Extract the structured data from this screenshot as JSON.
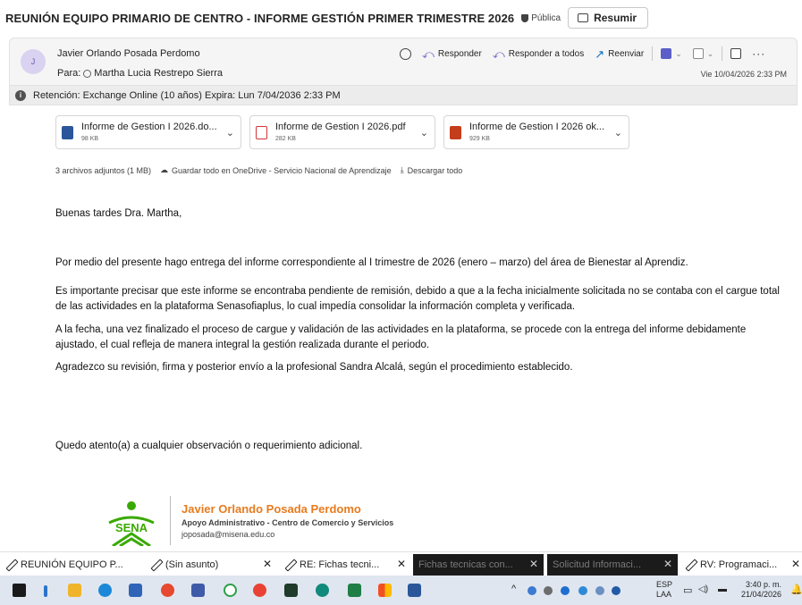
{
  "email": {
    "subject": "REUNIÓN EQUIPO PRIMARIO DE CENTRO - INFORME GESTIÓN PRIMER TRIMESTRE 2026",
    "visibility": "Pública",
    "summarize_label": "Resumir",
    "avatar_initial": "J",
    "sender": "Javier Orlando Posada Perdomo",
    "to_prefix": "Para:",
    "recipient": "Martha Lucia Restrepo Sierra",
    "date": "Vie 10/04/2026 2:33 PM",
    "retention": "Retención: Exchange Online (10 años) Expira: Lun 7/04/2036 2:33 PM",
    "actions": {
      "reply": "Responder",
      "reply_all": "Responder a todos",
      "forward": "Reenviar"
    }
  },
  "attachments": [
    {
      "name": "Informe de Gestion I 2026.do...",
      "size": "98 KB",
      "icon": "word-icon",
      "color": "#2b579a"
    },
    {
      "name": "Informe de Gestion I 2026.pdf",
      "size": "282 KB",
      "icon": "pdf-icon",
      "color": "#d13438"
    },
    {
      "name": "Informe de Gestion I 2026 ok...",
      "size": "929 KB",
      "icon": "powerpoint-icon",
      "color": "#c43e1c"
    }
  ],
  "attachments_summary": {
    "count": "3 archivos adjuntos (1 MB)",
    "save_onedrive": "Guardar todo en OneDrive - Servicio Nacional de Aprendizaje",
    "download_all": "Descargar todo"
  },
  "body": {
    "greeting": "Buenas tardes Dra. Martha,",
    "p1": "Por medio del presente hago entrega del informe correspondiente al I trimestre de 2026 (enero – marzo) del área de Bienestar al Aprendiz.",
    "p2": "Es importante precisar que este informe se encontraba pendiente de remisión, debido a que a la fecha inicialmente solicitada no se contaba con el cargue total de las actividades en la plataforma Senasofiaplus, lo cual impedía consolidar la información completa y verificada.",
    "p3": "A la fecha, una vez finalizado el proceso de cargue y validación de las actividades en la plataforma, se procede con la entrega del informe debidamente ajustado, el cual refleja de manera integral la gestión realizada durante el periodo.",
    "p4": "Agradezco su revisión, firma y posterior envío a la profesional Sandra Alcalá, según el procedimiento establecido.",
    "closing": "Quedo atento(a) a cualquier observación o requerimiento adicional."
  },
  "signature": {
    "logo_text": "SENA",
    "name": "Javier Orlando Posada Perdomo",
    "role": "Apoyo Administrativo - Centro de Comercio y Servicios",
    "email": "joposada@misena.edu.co"
  },
  "draft_tabs": [
    {
      "label": "REUNIÓN EQUIPO P..."
    },
    {
      "label": "(Sin asunto)"
    },
    {
      "label": "RE: Fichas tecni..."
    },
    {
      "label": "Fichas tecnicas con..."
    },
    {
      "label": "Solicitud Informaci..."
    },
    {
      "label": "RV: Programaci..."
    }
  ],
  "taskbar": {
    "language": "ESP",
    "layout": "LAA",
    "time": "3:40 p. m.",
    "date": "21/04/2026"
  },
  "colors": {
    "accent": "#0f6cbd",
    "sena_orange": "#e87b1e",
    "sena_green": "#39a900",
    "taskbar_bg": "#dfe6ef"
  }
}
